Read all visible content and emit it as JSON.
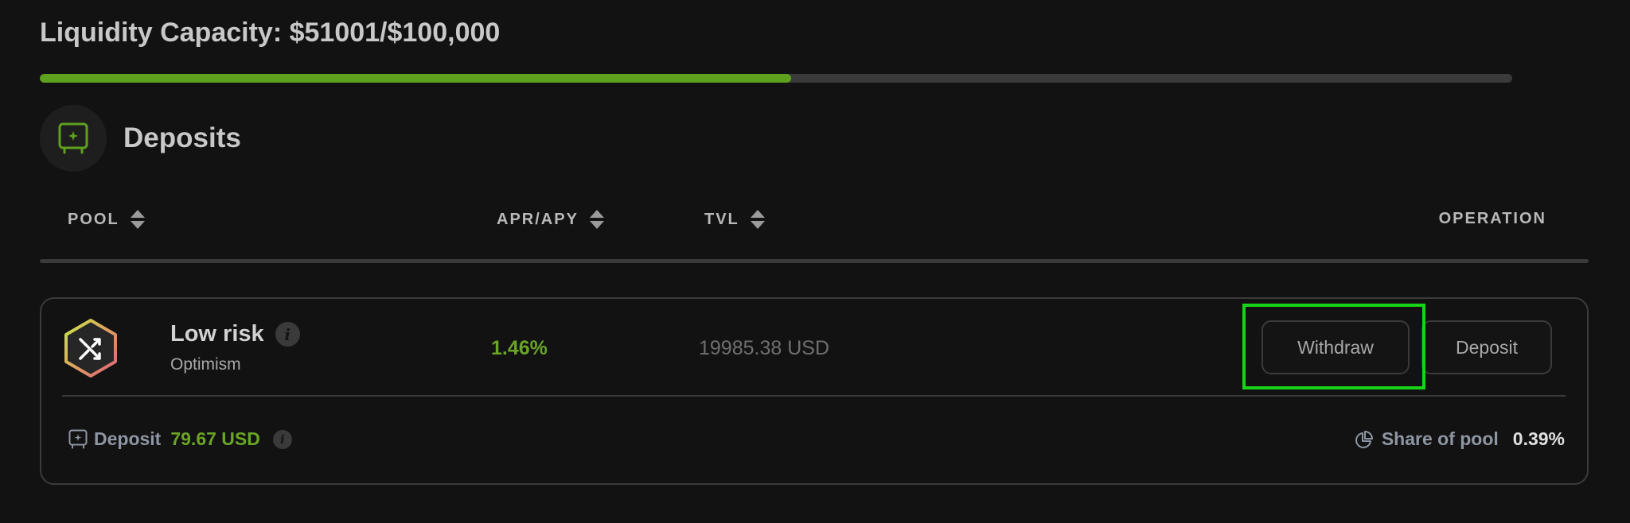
{
  "capacity": {
    "title": "Liquidity Capacity: $51001/$100,000",
    "current": 51001,
    "max": 100000,
    "progress_fraction": 0.51,
    "fill_color": "#5fa01e"
  },
  "deposits_section": {
    "title": "Deposits",
    "icon": "safe-icon"
  },
  "table": {
    "headers": {
      "pool": "POOL",
      "apr": "APR/APY",
      "tvl": "TVL",
      "operation": "OPERATION"
    }
  },
  "pool": {
    "name": "Low risk",
    "network": "Optimism",
    "apr": "1.46%",
    "tvl": "19985.38 USD",
    "icon": "shuffle-hexagon-icon",
    "buttons": {
      "withdraw": "Withdraw",
      "deposit": "Deposit"
    },
    "footer": {
      "deposit_label": "Deposit",
      "deposit_amount": "79.67 USD",
      "share_label": "Share of pool",
      "share_value": "0.39%"
    }
  },
  "colors": {
    "background": "#121212",
    "accent_green": "#6aa526",
    "highlight": "#16d516"
  }
}
